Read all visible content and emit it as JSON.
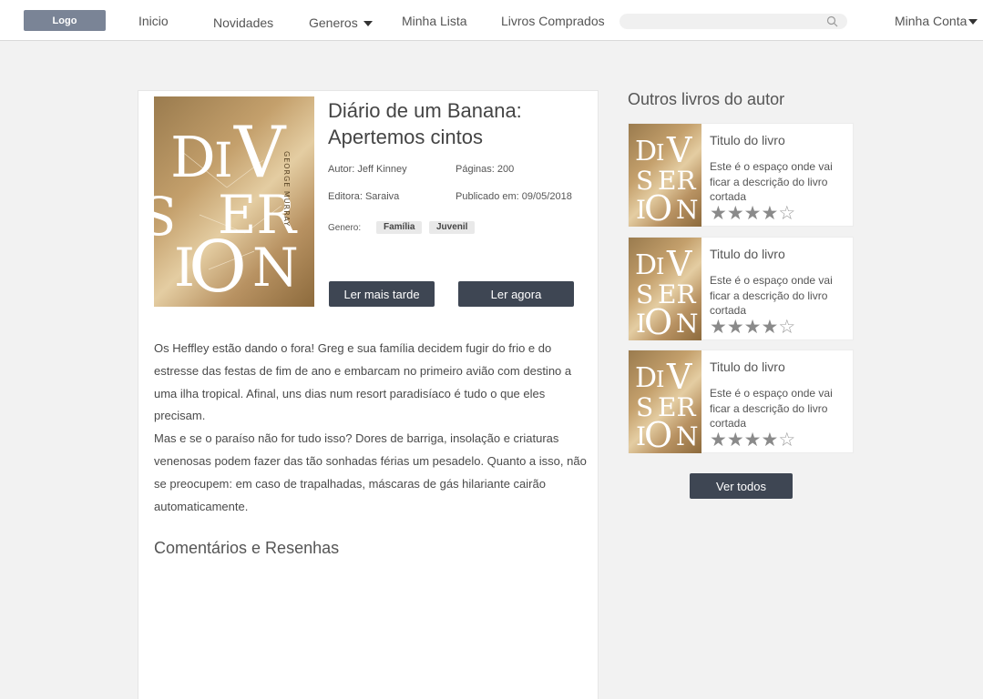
{
  "nav": {
    "logo": "Logo",
    "items": [
      "Inicio",
      "Novidades",
      "Generos",
      "Minha Lista",
      "Livros Comprados"
    ],
    "search_placeholder": "",
    "account": "Minha Conta"
  },
  "book": {
    "title": "Diário de um Banana: Apertemos cintos",
    "author": "Autor: Jeff Kinney",
    "pages": "Páginas: 200",
    "publisher": "Editora: Saraiva",
    "published": "Publicado em: 09/05/2018",
    "genre_label": "Genero:",
    "genres": [
      "Família",
      "Juvenil"
    ],
    "read_later": "Ler mais tarde",
    "read_now": "Ler agora",
    "cover": {
      "large_text": [
        "D",
        "I",
        "V",
        "ER",
        "S",
        "I",
        "O",
        "N"
      ],
      "author_vertical": "GEORGE MURRAY"
    }
  },
  "description": [
    "Os Heffley estão dando o fora! Greg e sua família decidem fugir do frio e do estresse das festas de fim de ano e embarcam no primeiro avião com destino a uma ilha tropical. Afinal, uns dias num resort paradisíaco é tudo o que eles precisam.",
    " Mas e se o paraíso não for tudo isso? Dores de barriga, insolação e criaturas venenosas podem fazer das tão sonhadas férias um pesadelo. Quanto a isso, não se preocupem: em caso de trapalhadas, máscaras de gás hilariante cairão automaticamente."
  ],
  "comments_title": "Comentários e Resenhas",
  "other_books": {
    "title": "Outros livros do autor",
    "items": [
      {
        "title": "Titulo do livro",
        "desc": "Este é o espaço onde vai ficar a descrição do livro cortada",
        "rating": 4,
        "max": 5
      },
      {
        "title": "Titulo do livro",
        "desc": "Este é o espaço onde vai ficar a descrição do livro cortada",
        "rating": 4,
        "max": 5
      },
      {
        "title": "Titulo do livro",
        "desc": "Este é o espaço onde vai ficar a descrição do livro cortada",
        "rating": 4,
        "max": 5
      }
    ],
    "see_all": "Ver todos"
  }
}
